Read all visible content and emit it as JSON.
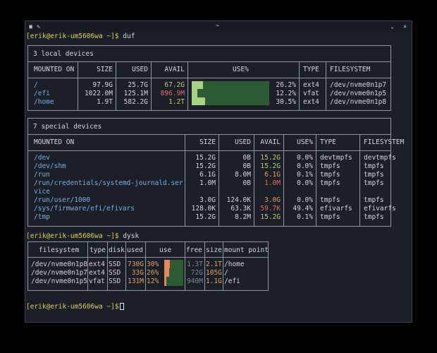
{
  "titlebar": {
    "title": "~"
  },
  "prompts": {
    "p1": {
      "user": "[erik@erik-um5606wa ~]$",
      "cmd": " duf"
    },
    "p2": {
      "user": "[erik@erik-um5606wa ~]$",
      "cmd": " dysk"
    },
    "p3": {
      "user": "[erik@erik-um5606wa ~]$",
      "cmd": ""
    }
  },
  "duf": {
    "local_title": "3 local devices",
    "local_headers": [
      "MOUNTED ON",
      "SIZE",
      "USED",
      "AVAIL",
      "USE%",
      "TYPE",
      "FILESYSTEM"
    ],
    "local_rows": [
      {
        "mount": "/",
        "size": "97.9G",
        "used": "25.7G",
        "avail": "67.2G",
        "use": "26.2%",
        "type": "ext4",
        "fs": "/dev/nvme0n1p7",
        "use_frac": 0.262
      },
      {
        "mount": "/efi",
        "size": "1022.0M",
        "used": "125.1M",
        "avail": "896.9M",
        "use": "12.2%",
        "type": "vfat",
        "fs": "/dev/nvme0n1p5",
        "use_frac": 0.122
      },
      {
        "mount": "/home",
        "size": "1.9T",
        "used": "582.2G",
        "avail": "1.2T",
        "use": "30.5%",
        "type": "ext4",
        "fs": "/dev/nvme0n1p8",
        "use_frac": 0.305
      }
    ],
    "special_title": "7 special devices",
    "special_headers": [
      "MOUNTED ON",
      "SIZE",
      "USED",
      "AVAIL",
      "USE%",
      "TYPE",
      "FILESYSTEM"
    ],
    "special_rows": [
      {
        "mount": "/dev",
        "size": "15.2G",
        "used": "0B",
        "avail": "15.2G",
        "use": "0.0%",
        "type": "devtmpfs",
        "fs": "devtmpfs"
      },
      {
        "mount": "/dev/shm",
        "size": "15.2G",
        "used": "0B",
        "avail": "15.2G",
        "use": "0.0%",
        "type": "tmpfs",
        "fs": "tmpfs"
      },
      {
        "mount": "/run",
        "size": "6.1G",
        "used": "8.0M",
        "avail": "6.1G",
        "use": "0.1%",
        "type": "tmpfs",
        "fs": "tmpfs"
      },
      {
        "mount": "/run/credentials/systemd-journald.ser",
        "size": "1.0M",
        "used": "0B",
        "avail": "1.0M",
        "use": "0.0%",
        "type": "tmpfs",
        "fs": "tmpfs"
      },
      {
        "mount": "vice",
        "size": "",
        "used": "",
        "avail": "",
        "use": "",
        "type": "",
        "fs": ""
      },
      {
        "mount": "/run/user/1000",
        "size": "3.0G",
        "used": "124.0K",
        "avail": "3.0G",
        "use": "0.0%",
        "type": "tmpfs",
        "fs": "tmpfs"
      },
      {
        "mount": "/sys/firmware/efi/efivars",
        "size": "128.0K",
        "used": "63.3K",
        "avail": "59.7K",
        "use": "49.4%",
        "type": "efivarfs",
        "fs": "efivarfs"
      },
      {
        "mount": "/tmp",
        "size": "15.2G",
        "used": "8.2M",
        "avail": "15.2G",
        "use": "0.1%",
        "type": "tmpfs",
        "fs": "tmpfs"
      }
    ]
  },
  "dysk": {
    "headers": [
      "filesystem",
      "type",
      "disk",
      "used",
      "use",
      "free",
      "size",
      "mount point"
    ],
    "rows": [
      {
        "fs": "/dev/nvme0n1p8",
        "type": "ext4",
        "disk": "SSD",
        "used": "730G",
        "pct": "30%",
        "free": "1.3T",
        "size": "2.1T",
        "mount": "/home",
        "use_frac": 0.3
      },
      {
        "fs": "/dev/nvme0n1p7",
        "type": "ext4",
        "disk": "SSD",
        "used": "33G",
        "pct": "26%",
        "free": "72G",
        "size": "105G",
        "mount": "/",
        "use_frac": 0.26
      },
      {
        "fs": "/dev/nvme0n1p5",
        "type": "vfat",
        "disk": "SSD",
        "used": "131M",
        "pct": "12%",
        "free": "940M",
        "size": "1.1G",
        "mount": "/efi",
        "use_frac": 0.12
      }
    ]
  }
}
